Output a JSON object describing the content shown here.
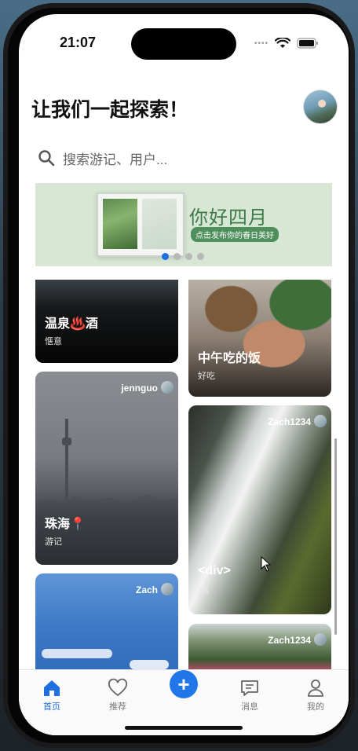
{
  "status": {
    "time": "21:07",
    "dots": "••••"
  },
  "header": {
    "title": "让我们一起探索！"
  },
  "search": {
    "placeholder": "搜索游记、用户..."
  },
  "banner": {
    "title": "你好四月",
    "subtitle": "点击发布你的春日美好",
    "pages": 4,
    "active_page": 1
  },
  "cards": [
    {
      "title": "温泉♨️酒",
      "subtitle": "惬意",
      "author": ""
    },
    {
      "title": "中午吃的饭",
      "subtitle": "好吃",
      "author": ""
    },
    {
      "title": "珠海📍",
      "subtitle": "游记",
      "author": "jennguo"
    },
    {
      "title": "<div>",
      "subtitle": "&&",
      "author": "Zach1234"
    },
    {
      "title": "",
      "subtitle": "",
      "author": "Zach"
    },
    {
      "title": "",
      "subtitle": "",
      "author": "Zach1234"
    }
  ],
  "tabs": [
    {
      "label": "首页",
      "icon": "home-icon",
      "active": true
    },
    {
      "label": "推荐",
      "icon": "heart-icon",
      "active": false
    },
    {
      "label": "",
      "icon": "plus-icon",
      "active": false
    },
    {
      "label": "消息",
      "icon": "message-icon",
      "active": false
    },
    {
      "label": "我的",
      "icon": "user-icon",
      "active": false
    }
  ],
  "colors": {
    "accent": "#1f6fe0",
    "add_button": "#2176ea"
  }
}
